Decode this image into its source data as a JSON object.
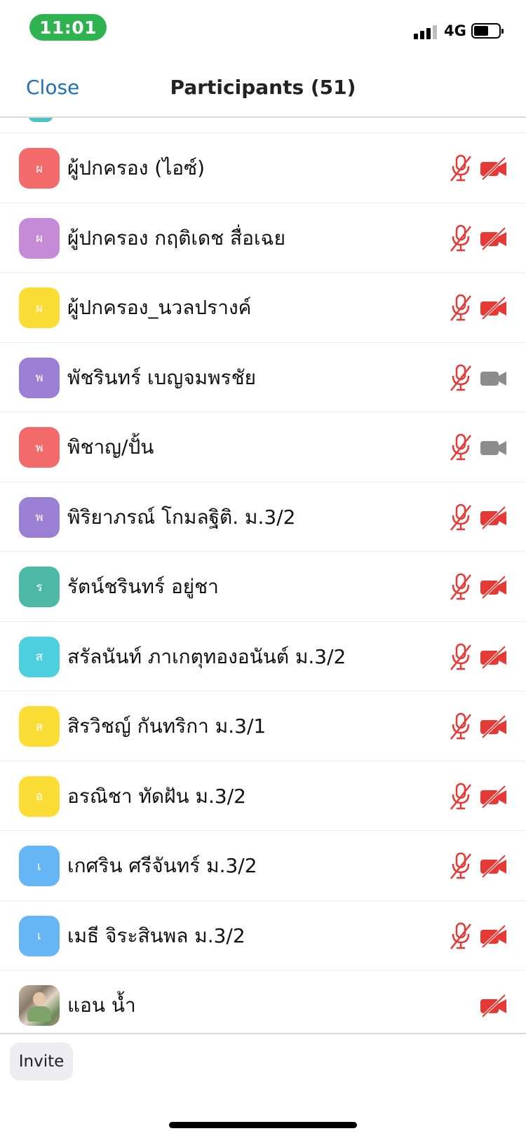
{
  "status_bar": {
    "time": "11:01",
    "network": "4G",
    "signal_bars_active": 3,
    "signal_bars_total": 4,
    "battery_level": 0.6
  },
  "header": {
    "close_label": "Close",
    "title": "Participants (51)"
  },
  "colors": {
    "accent": "#1f6fb6",
    "muted_red": "#e53935",
    "camera_on_gray": "#8c8c8c",
    "time_pill": "#2fb350"
  },
  "participants": [
    {
      "name": "ผู้ปกครอง (ไอซ์)",
      "initial": "ผ",
      "color": "#f26a6a",
      "mic": "muted",
      "video": "off"
    },
    {
      "name": "ผู้ปกครอง กฤติเดช สื่อเฉย",
      "initial": "ผ",
      "color": "#c58bd6",
      "mic": "muted",
      "video": "off"
    },
    {
      "name": "ผู้ปกครอง_นวลปรางค์",
      "initial": "ผ",
      "color": "#fbdd36",
      "mic": "muted",
      "video": "off"
    },
    {
      "name": "พัชรินทร์ เบญจมพรชัย",
      "initial": "พ",
      "color": "#9b7fd4",
      "mic": "muted",
      "video": "on"
    },
    {
      "name": "พิชาญ/ปั้น",
      "initial": "พ",
      "color": "#f26a6a",
      "mic": "muted",
      "video": "on"
    },
    {
      "name": "พิริยาภรณ์  โกมลฐิติ. ม.3/2",
      "initial": "พ",
      "color": "#9b7fd4",
      "mic": "muted",
      "video": "off"
    },
    {
      "name": "รัตน์ชรินทร์  อยู่ชา",
      "initial": "ร",
      "color": "#4db8a6",
      "mic": "muted",
      "video": "off"
    },
    {
      "name": "สรัลนันท์ ภาเกตุทองอนันต์  ม.3/2",
      "initial": "ส",
      "color": "#4ecfe0",
      "mic": "muted",
      "video": "off"
    },
    {
      "name": "สิรวิชญ์ กันทริกา ม.3/1",
      "initial": "ส",
      "color": "#fbdd36",
      "mic": "muted",
      "video": "off"
    },
    {
      "name": "อรณิชา ทัดฝัน ม.3/2",
      "initial": "อ",
      "color": "#fbdd36",
      "mic": "muted",
      "video": "off"
    },
    {
      "name": "เกศริน ศรีจันทร์ ม.3/2",
      "initial": "เ",
      "color": "#66b5f5",
      "mic": "muted",
      "video": "off"
    },
    {
      "name": "เมธี จิระสินพล ม.3/2",
      "initial": "เ",
      "color": "#66b5f5",
      "mic": "muted",
      "video": "off"
    },
    {
      "name": "แอน น้ำ",
      "initial": "",
      "color": "#b9a38c",
      "photo": true,
      "mic": "none",
      "video": "off"
    }
  ],
  "footer": {
    "invite_label": "Invite"
  }
}
